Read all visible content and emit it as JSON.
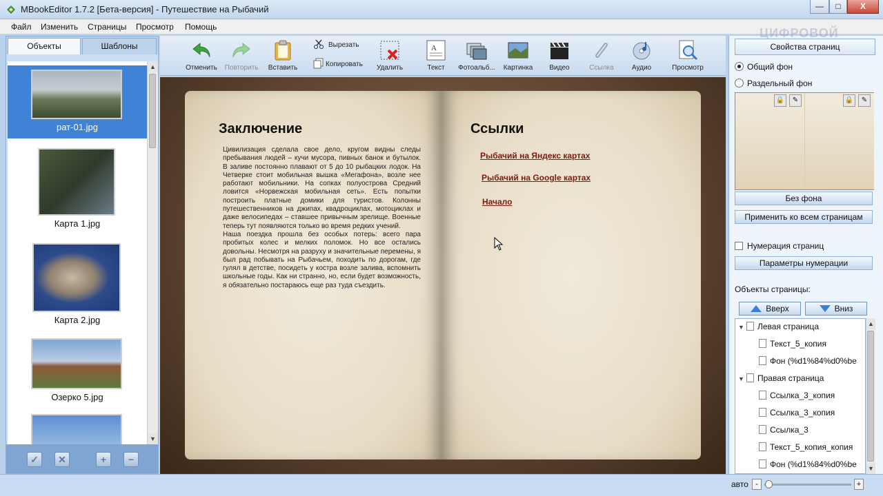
{
  "window": {
    "title": "MBookEditor 1.7.2 [Бета-версия] - Путешествие на Рыбачий",
    "controls": {
      "minimize": "—",
      "maximize": "□",
      "close": "X"
    }
  },
  "menu": [
    "Файл",
    "Изменить",
    "Страницы",
    "Просмотр",
    "Помощь"
  ],
  "left_panel": {
    "tabs": [
      "Объекты",
      "Шаблоны"
    ],
    "thumbnails": [
      {
        "caption": "рат-01.jpg",
        "selected": true
      },
      {
        "caption": "Карта 1.jpg",
        "selected": false
      },
      {
        "caption": "Карта 2.jpg",
        "selected": false
      },
      {
        "caption": "Озерко 5.jpg",
        "selected": false
      },
      {
        "caption": "",
        "selected": false
      }
    ],
    "footer_icons": [
      "check-icon",
      "delete-icon",
      "add-icon",
      "remove-icon"
    ]
  },
  "toolbar": {
    "undo": "Отменить",
    "redo": "Повторить",
    "paste": "Вставить",
    "cut": "Вырезать",
    "copy": "Копировать",
    "delete": "Удалить",
    "text": "Текст",
    "photo_album": "Фотоальб...",
    "picture": "Картинка",
    "video": "Видео",
    "link": "Ссылка",
    "audio": "Аудио",
    "preview": "Просмотр"
  },
  "book": {
    "left": {
      "heading": "Заключение",
      "paragraphs": [
        "Цивилизация сделала свое дело, кругом видны следы пребывания людей – кучи мусора, пивных банок и бутылок. В заливе постоянно плавают от 5 до 10 рыбацких лодок. На Четверке стоит мобильная вышка «Мегафона», возле нее работают мобильники. На сопках полуострова Средний ловится «Норвежская мобильная сеть». Есть попытки построить платные домики для туристов. Колонны путешественников на джипах, квадроциклах, мотоциклах и даже велосипедах – ставшее привычным зрелище. Военные теперь тут появляются только во время редких учений.",
        "Наша поездка прошла без особых потерь: всего пара пробитых колес и мелких поломок. Но все остались довольны. Несмотря на разруху и значительные перемены, я был рад побывать на Рыбачьем, походить по дорогам, где гулял в детстве, посидеть у костра возле залива, вспомнить школьные годы. Как ни странно, но, если будет возможность, я обязательно постараюсь еще раз туда съездить."
      ]
    },
    "right": {
      "heading": "Ссылки",
      "links": [
        "Рыбачий на Яндекс картах",
        "Рыбачий на Google картах",
        "Начало"
      ]
    }
  },
  "right_panel": {
    "tab": "Свойства страниц",
    "watermark": "ЦИФРОВОЙ",
    "bg_mode": {
      "common": "Общий фон",
      "separate": "Раздельный фон",
      "selected": "common"
    },
    "no_background": "Без фона",
    "apply_all": "Применить ко всем страницам",
    "numbering_checkbox": "Нумерация страниц",
    "numbering_params": "Параметры нумерации",
    "objects_label": "Объекты страницы:",
    "up": "Вверх",
    "down": "Вниз",
    "tree": [
      {
        "label": "Левая страница",
        "level": 0
      },
      {
        "label": "Текст_5_копия",
        "level": 1
      },
      {
        "label": "Фон (%d1%84%d0%be",
        "level": 1
      },
      {
        "label": "Правая страница",
        "level": 0
      },
      {
        "label": "Ссылка_3_копия",
        "level": 1
      },
      {
        "label": "Ссылка_3_копия",
        "level": 1
      },
      {
        "label": "Ссылка_3",
        "level": 1
      },
      {
        "label": "Текст_5_копия_копия",
        "level": 1
      },
      {
        "label": "Фон (%d1%84%d0%be",
        "level": 1
      }
    ]
  },
  "statusbar": {
    "zoom_label": "авто",
    "minus": "-",
    "plus": "+",
    "zoom_level": 0.05
  },
  "colors": {
    "accent": "#3f83d6",
    "link": "#7b1c12",
    "panel": "#cddff2"
  }
}
